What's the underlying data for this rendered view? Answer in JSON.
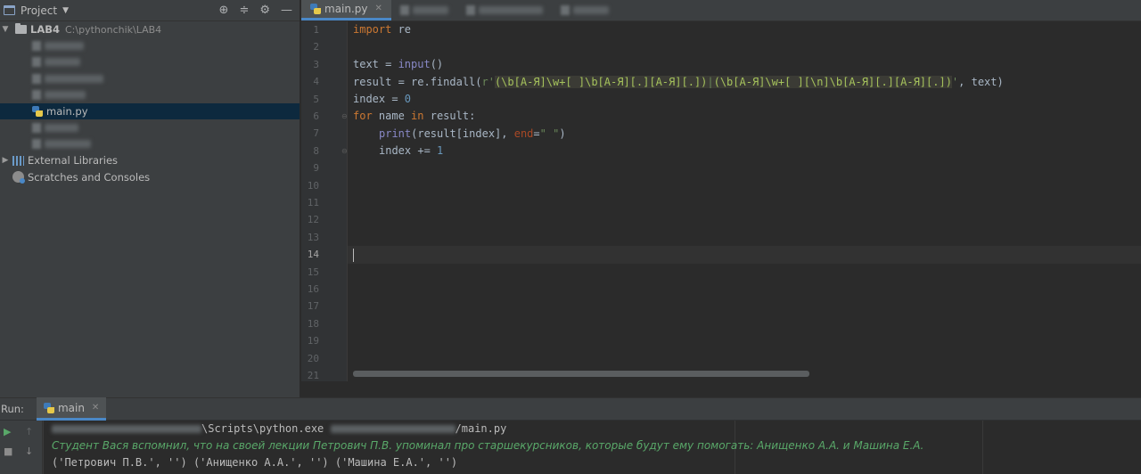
{
  "project_panel": {
    "title": "Project",
    "root_name": "LAB4",
    "root_path": "C:\\pythonchik\\LAB4",
    "selected_file": "main.py",
    "external_libraries": "External Libraries",
    "scratches": "Scratches and Consoles"
  },
  "editor": {
    "active_tab": "main.py",
    "current_line": 14,
    "line_numbers": [
      "1",
      "2",
      "3",
      "4",
      "5",
      "6",
      "7",
      "8",
      "9",
      "10",
      "11",
      "12",
      "13",
      "14",
      "15",
      "16",
      "17",
      "18",
      "19",
      "20",
      "21"
    ],
    "code": {
      "l1_kw": "import",
      "l1_mod": " re",
      "l3_var": "text = ",
      "l3_fn": "input",
      "l3_end": "()",
      "l4_start": "result = re.findall(",
      "l4_r": "r'",
      "l4_g1": "(\\b[А-Я]\\w+[ ]\\b[А-Я][.][А-Я][.])",
      "l4_pipe": "|",
      "l4_g2": "(\\b[А-Я]\\w+[ ][\\n]\\b[А-Я][.][А-Я][.])",
      "l4_q": "'",
      "l4_end": ", text)",
      "l5_var": "index = ",
      "l5_num": "0",
      "l6_kw1": "for",
      "l6_mid": " name ",
      "l6_kw2": "in",
      "l6_end": " result:",
      "l7_fn": "print",
      "l7_args": "(result[index], ",
      "l7_kwarg": "end",
      "l7_eq": "=",
      "l7_str": "\" \"",
      "l7_close": ")",
      "l8_var": "index += ",
      "l8_num": "1"
    }
  },
  "run_panel": {
    "label": "Run:",
    "tab": "main",
    "command_mid": "\\Scripts\\python.exe",
    "command_end": "/main.py",
    "input_line": "Студент Вася вспомнил, что на своей лекции Петрович П.В. упоминал про старшекурсников, которые будут ему помогать: Анищенко А.А. и Машина Е.А.",
    "output_line": "('Петрович П.В.', '') ('Анищенко А.А.', '') ('Машина Е.А.', '')"
  },
  "colors": {
    "keyword": "#cc7832",
    "builtin": "#8888c6",
    "number": "#6897bb",
    "string": "#6a8759",
    "selection": "#0d293e",
    "accent": "#4a88c7",
    "console_input": "#59a869"
  },
  "icons": {
    "project": "folder-icon",
    "python_file": "python-file-icon",
    "run": "play-icon",
    "stop": "stop-icon"
  }
}
